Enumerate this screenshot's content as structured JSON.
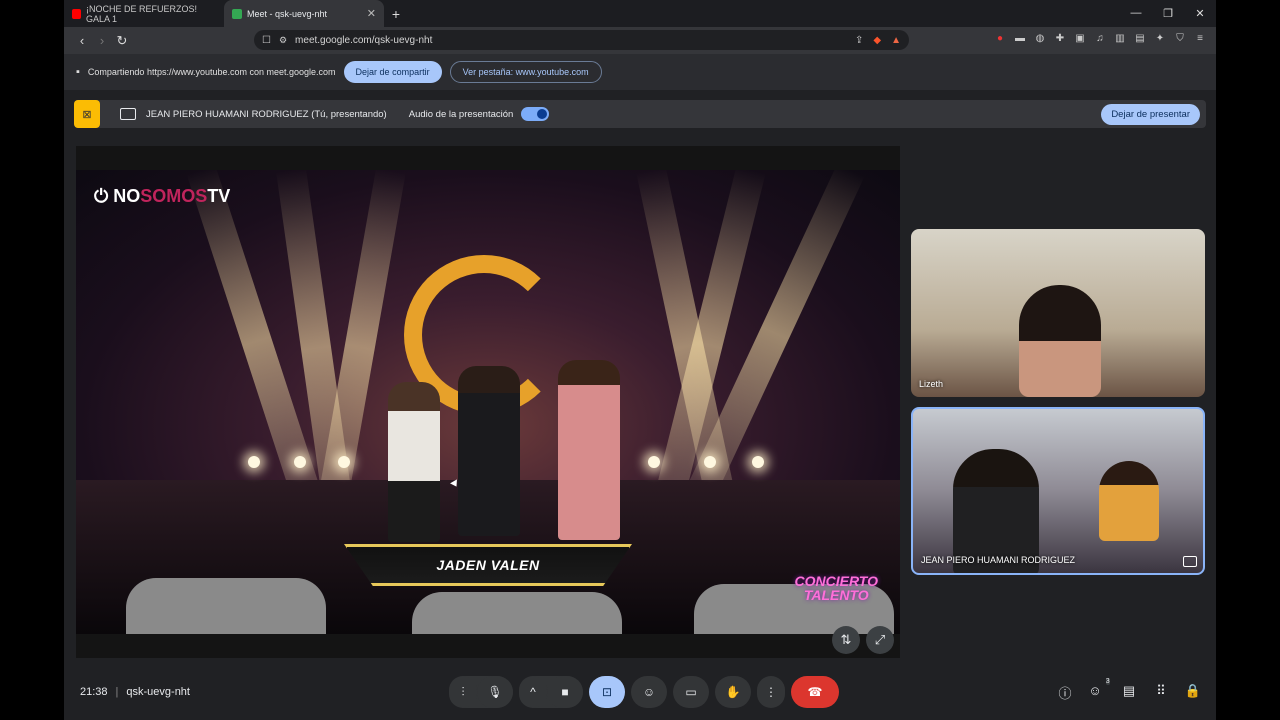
{
  "tabs": [
    {
      "label": "¡NOCHE DE REFUERZOS! GALA 1",
      "favicon_color": "#ff0000"
    },
    {
      "label": "Meet - qsk-uevg-nht",
      "favicon_color": "#34a853",
      "active": true
    }
  ],
  "address": {
    "url": "meet.google.com/qsk-uevg-nht"
  },
  "share_bar": {
    "text": "Compartiendo https://www.youtube.com con meet.google.com",
    "stop_label": "Dejar de compartir",
    "view_tab_label": "Ver pestaña: www.youtube.com"
  },
  "presentation": {
    "presenter": "JEAN PIERO HUAMANI RODRIGUEZ (Tú, presentando)",
    "audio_label": "Audio de la presentación",
    "audio_on": true,
    "stop_label": "Dejar de presentar"
  },
  "video": {
    "brand_a": "NO",
    "brand_b": "SOMOS",
    "brand_c": "TV",
    "caption": "JADEN VALEN",
    "watermark_1": "CONCIERTO",
    "watermark_2": "TALENTO"
  },
  "participants": [
    {
      "name": "Lizeth"
    },
    {
      "name": "JEAN PIERO HUAMANI RODRIGUEZ"
    }
  ],
  "meeting": {
    "time": "21:38",
    "code": "qsk-uevg-nht",
    "people_count": "3"
  },
  "colors": {
    "accent": "#a8c7fa",
    "end_call": "#dc362e",
    "present_badge": "#fbbc04"
  }
}
